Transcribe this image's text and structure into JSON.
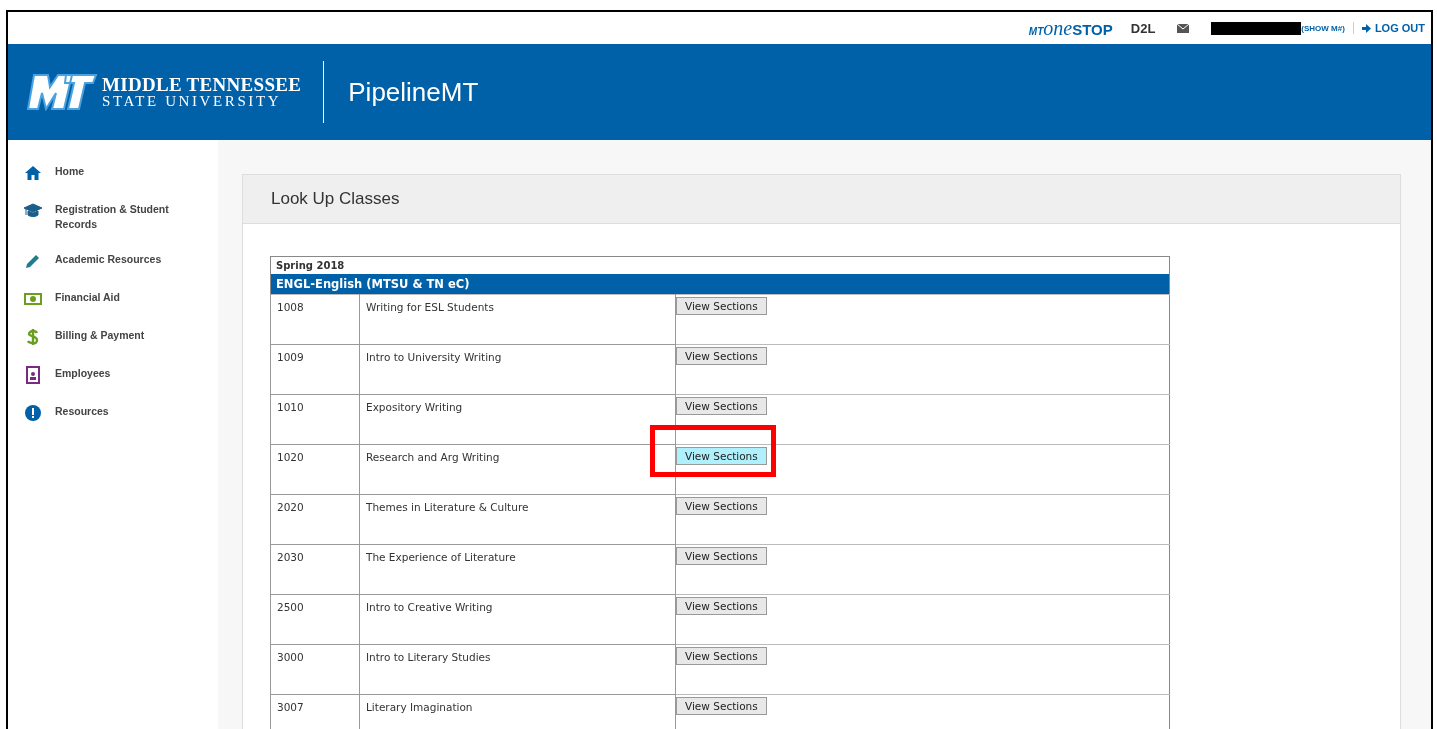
{
  "top_bar": {
    "onestop_logo": {
      "prefix": "MT",
      "word": "one",
      "suffix": "STOP"
    },
    "d2l": "D2L",
    "show_m": "(SHOW M#)",
    "logout": "LOG OUT"
  },
  "header": {
    "university_line_1": "MIDDLE TENNESSEE",
    "university_line_2": "STATE UNIVERSITY",
    "app_title": "PipelineMT"
  },
  "sidebar": {
    "items": [
      {
        "kind": "home",
        "label": "Home"
      },
      {
        "kind": "cap",
        "label": "Registration & Student Records"
      },
      {
        "kind": "pencil",
        "label": "Academic Resources"
      },
      {
        "kind": "money",
        "label": "Financial Aid"
      },
      {
        "kind": "dollar",
        "label": "Billing & Payment"
      },
      {
        "kind": "badge",
        "label": "Employees"
      },
      {
        "kind": "alert",
        "label": "Resources"
      }
    ]
  },
  "panel": {
    "title": "Look Up Classes",
    "table": {
      "term": "Spring 2018",
      "subject": "ENGL-English (MTSU & TN eC)",
      "rows": [
        {
          "number": "1008",
          "title": "Writing for ESL Students",
          "button": "View Sections",
          "highlighted": false
        },
        {
          "number": "1009",
          "title": "Intro to University Writing",
          "button": "View Sections",
          "highlighted": false
        },
        {
          "number": "1010",
          "title": "Expository Writing",
          "button": "View Sections",
          "highlighted": false
        },
        {
          "number": "1020",
          "title": "Research and Arg Writing",
          "button": "View Sections",
          "highlighted": true
        },
        {
          "number": "2020",
          "title": "Themes in Literature & Culture",
          "button": "View Sections",
          "highlighted": false
        },
        {
          "number": "2030",
          "title": "The Experience of Literature",
          "button": "View Sections",
          "highlighted": false
        },
        {
          "number": "2500",
          "title": "Intro to Creative Writing",
          "button": "View Sections",
          "highlighted": false
        },
        {
          "number": "3000",
          "title": "Intro to Literary Studies",
          "button": "View Sections",
          "highlighted": false
        },
        {
          "number": "3007",
          "title": "Literary Imagination",
          "button": "View Sections",
          "highlighted": false
        }
      ]
    }
  }
}
